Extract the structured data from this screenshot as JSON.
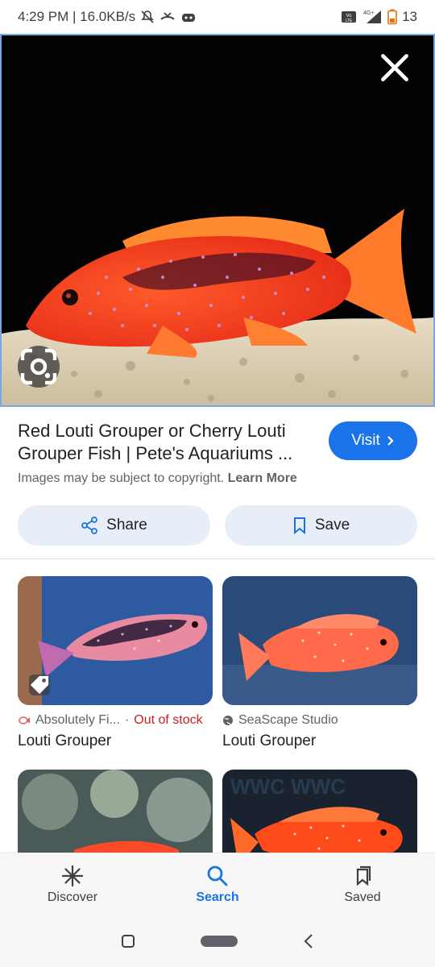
{
  "status_bar": {
    "time_speed": "4:29 PM | 16.0KB/s",
    "network": "4G+",
    "volte": "Vo LTE",
    "battery": "13"
  },
  "hero": {
    "close_icon": "close-icon",
    "lens_icon": "lens-icon"
  },
  "info": {
    "title": "Red Louti Grouper or Cherry Louti Grouper Fish | Pete's Aquariums ...",
    "visit_label": "Visit",
    "copyright_text": "Images may be subject to copyright.",
    "learn_more": "Learn More",
    "share_label": "Share",
    "save_label": "Save"
  },
  "results": [
    {
      "source": "Absolutely Fi...",
      "status": "Out of stock",
      "title": "Louti Grouper"
    },
    {
      "source": "SeaScape Studio",
      "title": "Louti Grouper"
    }
  ],
  "bottom_nav": {
    "discover": "Discover",
    "search": "Search",
    "saved": "Saved"
  },
  "colors": {
    "accent": "#1a73e8",
    "out_of_stock": "#c5221f"
  }
}
